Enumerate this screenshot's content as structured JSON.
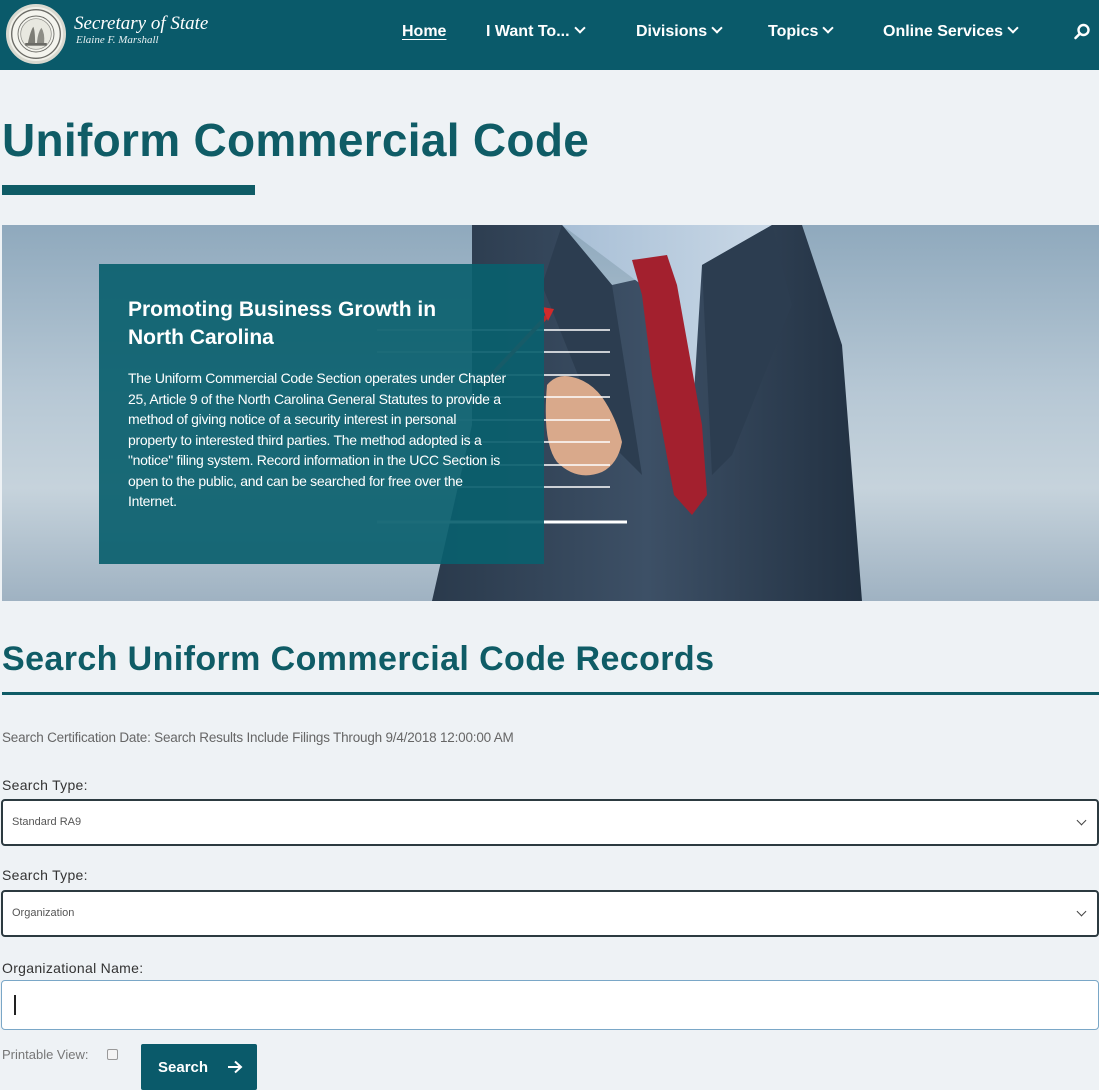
{
  "header": {
    "brand_title": "Secretary of State",
    "brand_subtitle": "Elaine F. Marshall",
    "nav": [
      {
        "label": "Home"
      },
      {
        "label": "I Want To..."
      },
      {
        "label": "Divisions"
      },
      {
        "label": "Topics"
      },
      {
        "label": "Online Services"
      }
    ]
  },
  "page": {
    "title": "Uniform Commercial Code"
  },
  "hero": {
    "heading": "Promoting Business Growth in North Carolina",
    "body": "The Uniform Commercial Code Section operates under Chapter 25, Article 9 of the North Carolina General Statutes to provide a method of giving notice of a security interest in personal property to interested third parties. The method adopted is a \"notice\" filing system. Record information in the UCC Section is open to the public, and can be searched for free over the Internet."
  },
  "search": {
    "title": "Search Uniform Commercial Code Records",
    "certification": "Search Certification Date: Search Results Include Filings Through 9/4/2018 12:00:00 AM",
    "search_type_label_1": "Search Type:",
    "search_type_value_1": "Standard RA9",
    "search_type_label_2": "Search Type:",
    "search_type_value_2": "Organization",
    "org_name_label": "Organizational Name:",
    "org_name_value": "",
    "printable_view_label": "Printable View:",
    "printable_view_checked": false,
    "search_button": "Search"
  },
  "colors": {
    "header_bg": "#0a5a6a",
    "title_text": "#0f5c66",
    "hero_card": "#0a606e"
  }
}
